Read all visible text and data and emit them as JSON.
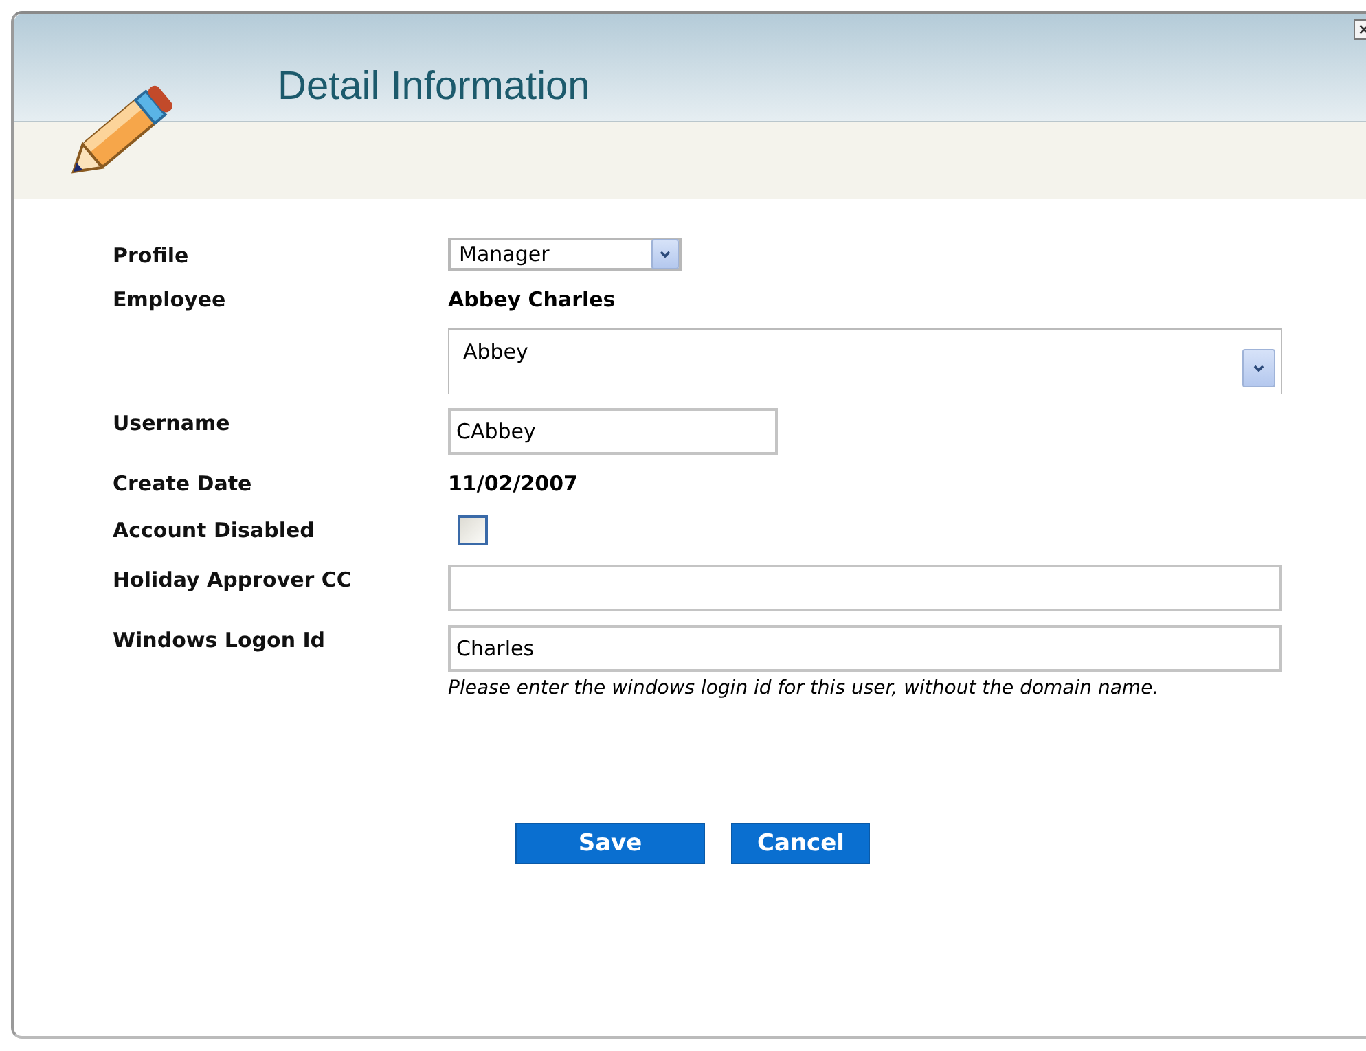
{
  "dialog": {
    "title": "Detail Information"
  },
  "fields": [
    {
      "kind": "select",
      "label": "Profile",
      "value": "Manager"
    },
    {
      "kind": "lookup",
      "label": "Employee",
      "text": "Abbey Charles",
      "value": "Abbey"
    },
    {
      "kind": "input",
      "label": "Username",
      "value": "CAbbey"
    },
    {
      "kind": "text",
      "label": "Create Date",
      "text": "11/02/2007"
    },
    {
      "kind": "checkbox",
      "label": "Account Disabled",
      "checked": false
    },
    {
      "kind": "wideinput",
      "label": "Holiday Approver CC"
    },
    {
      "kind": "wideinput",
      "label": "Windows Logon Id",
      "value": "Charles",
      "note": "Please enter the windows login id for this user, without the domain name."
    }
  ],
  "buttons": [
    {
      "label": "Save"
    },
    {
      "label": "Cancel"
    }
  ]
}
